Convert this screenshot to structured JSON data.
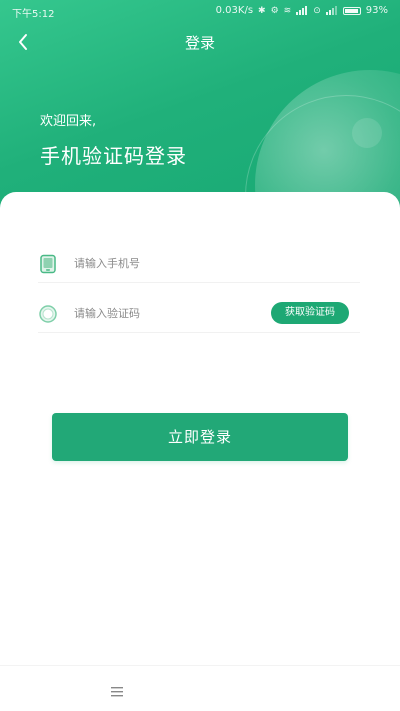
{
  "status_bar": {
    "time": "下午5:12",
    "network_speed": "0.03K/s",
    "battery": "93%"
  },
  "nav": {
    "title": "登录",
    "back_icon": "chevron-left-icon"
  },
  "hero": {
    "welcome": "欢迎回来,",
    "headline": "手机验证码登录"
  },
  "form": {
    "phone": {
      "icon": "phone-icon",
      "placeholder": "请输入手机号",
      "value": ""
    },
    "code": {
      "icon": "circle-icon",
      "placeholder": "请输入验证码",
      "value": "",
      "get_code_label": "获取验证码"
    },
    "submit_label": "立即登录"
  },
  "bottom_bar": {
    "menu_icon": "menu-icon"
  },
  "colors": {
    "accent": "#1ea874",
    "hero_top": "#35c78e",
    "hero_bottom": "#17a873"
  }
}
